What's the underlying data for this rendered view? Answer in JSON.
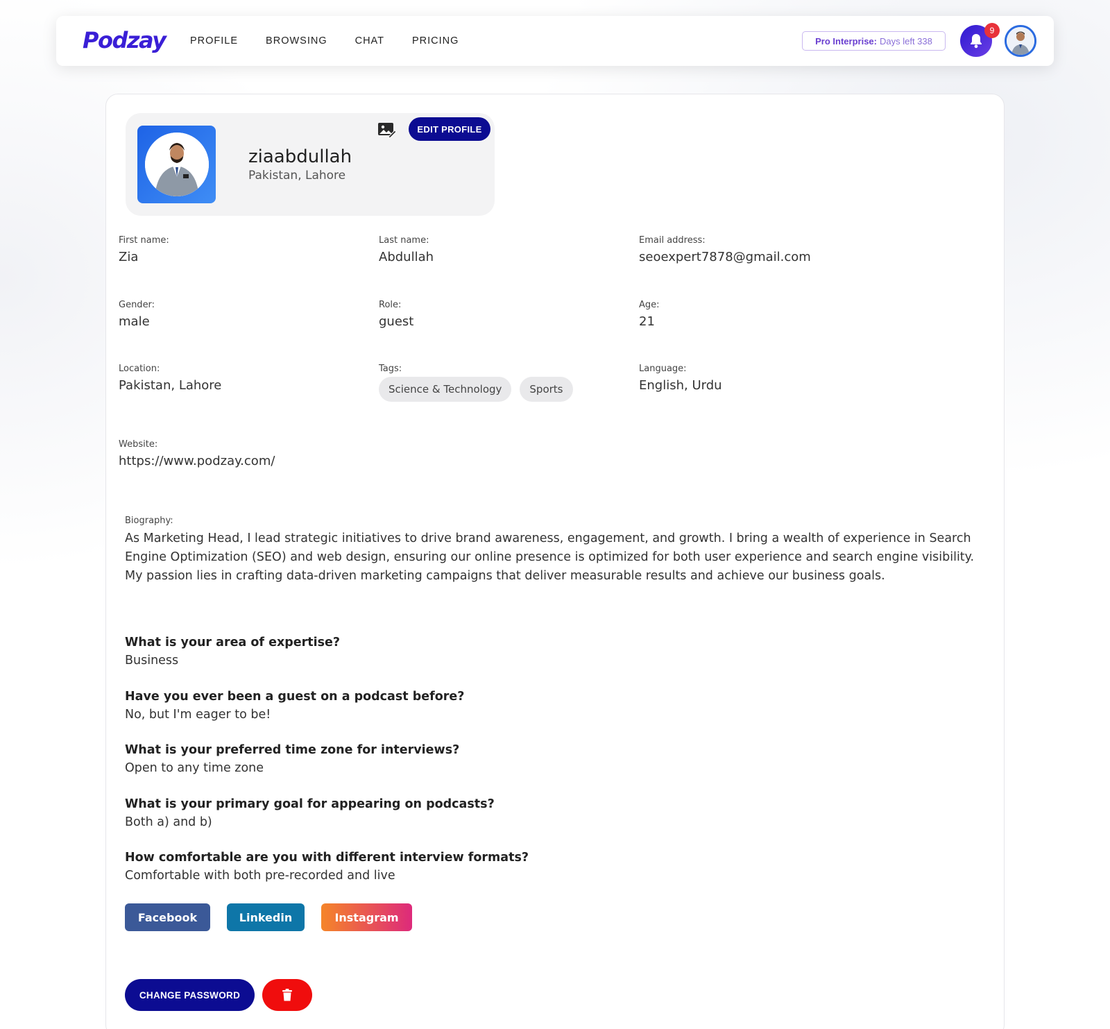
{
  "nav": {
    "logo": "Podzay",
    "links": [
      "PROFILE",
      "BROWSING",
      "CHAT",
      "PRICING"
    ],
    "plan_label": "Pro Interprise:",
    "plan_days": "Days left 338",
    "notification_count": "9"
  },
  "profile": {
    "username": "ziaabdullah",
    "location": "Pakistan, Lahore",
    "edit_label": "EDIT PROFILE"
  },
  "fields": {
    "first_name": {
      "label": "First name:",
      "value": "Zia"
    },
    "last_name": {
      "label": "Last name:",
      "value": "Abdullah"
    },
    "email": {
      "label": "Email address:",
      "value": "seoexpert7878@gmail.com"
    },
    "gender": {
      "label": "Gender:",
      "value": "male"
    },
    "role": {
      "label": "Role:",
      "value": "guest"
    },
    "age": {
      "label": "Age:",
      "value": "21"
    },
    "location": {
      "label": "Location:",
      "value": "Pakistan, Lahore"
    },
    "tags": {
      "label": "Tags:",
      "items": [
        "Science & Technology",
        "Sports"
      ]
    },
    "language": {
      "label": "Language:",
      "value": "English, Urdu"
    },
    "website": {
      "label": "Website:",
      "value": "https://www.podzay.com/"
    }
  },
  "biography": {
    "label": "Biography:",
    "text": "As Marketing Head, I lead strategic initiatives to drive brand awareness, engagement, and growth. I bring a wealth of experience in Search Engine Optimization (SEO) and web design, ensuring our online presence is optimized for both user experience and search engine visibility. My passion lies in crafting data-driven marketing campaigns that deliver measurable results and achieve our business goals."
  },
  "questions": [
    {
      "q": "What is your area of expertise?",
      "a": "Business"
    },
    {
      "q": "Have you ever been a guest on a podcast before?",
      "a": "No, but I'm eager to be!"
    },
    {
      "q": "What is your preferred time zone for interviews?",
      "a": "Open to any time zone"
    },
    {
      "q": "What is your primary goal for appearing on podcasts?",
      "a": "Both a) and b)"
    },
    {
      "q": "How comfortable are you with different interview formats?",
      "a": "Comfortable with both pre-recorded and live"
    }
  ],
  "social": {
    "facebook": "Facebook",
    "linkedin": "Linkedin",
    "instagram": "Instagram"
  },
  "actions": {
    "change_password": "CHANGE PASSWORD"
  },
  "colors": {
    "brand": "#3a1fd6",
    "primary_button": "#0c0c92",
    "danger": "#f00d0d",
    "facebook": "#3b5998",
    "linkedin": "#0e76a8"
  },
  "icons": [
    "bell-icon",
    "avatar",
    "image-edit-icon",
    "trash-icon"
  ]
}
